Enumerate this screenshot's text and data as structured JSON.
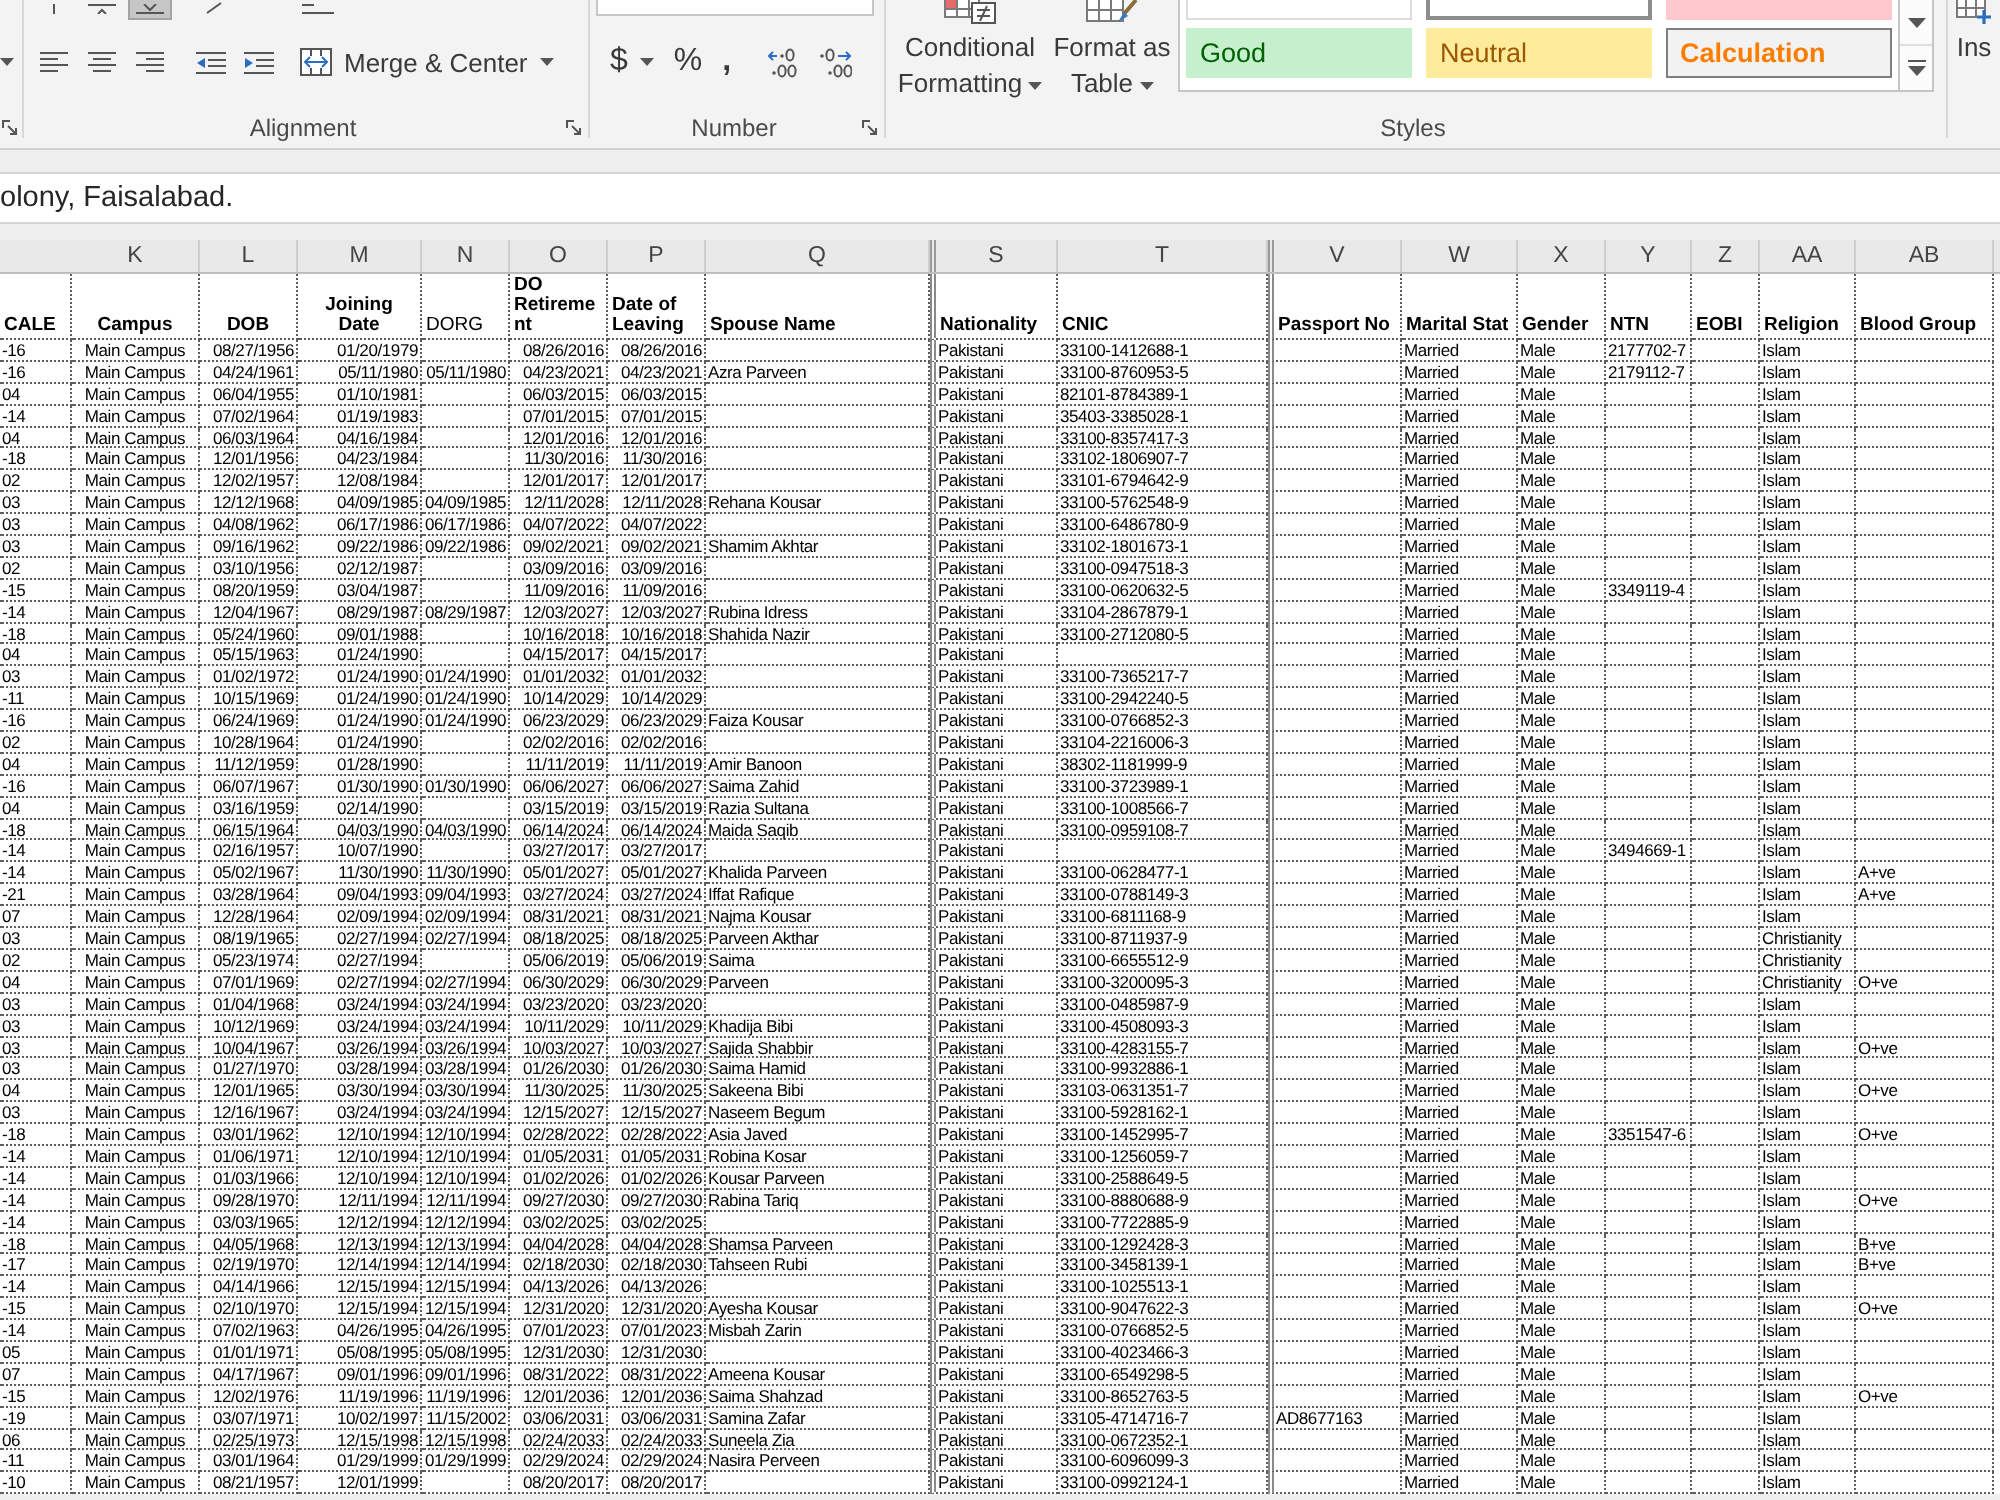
{
  "ribbon": {
    "alignment": {
      "vertical_align": [
        {
          "kind": "top",
          "selected": false
        },
        {
          "kind": "middle",
          "selected": false
        },
        {
          "kind": "bottom",
          "selected": true
        }
      ],
      "horizontal_align": [
        {
          "kind": "left",
          "selected": false
        },
        {
          "kind": "center",
          "selected": false
        },
        {
          "kind": "right",
          "selected": false
        }
      ],
      "merge": "Merge & Center",
      "label": "Alignment"
    },
    "number": {
      "currency": "$",
      "percent": "%",
      "comma": ",",
      "label": "Number"
    },
    "styles": {
      "conditional_formatting": "Conditional Formatting",
      "format_as_table": "Format as Table",
      "gallery": [
        {
          "kind": "normal",
          "selected": false
        },
        {
          "kind": "normal",
          "selected": true
        },
        {
          "kind": "bad",
          "selected": false
        },
        {
          "label": "Good",
          "kind": "good",
          "selected": false
        },
        {
          "label": "Neutral",
          "kind": "neutral",
          "selected": false
        },
        {
          "label": "Calculation",
          "kind": "calculation",
          "selected": false
        }
      ],
      "label": "Styles"
    },
    "cells": {
      "insert": "Ins"
    }
  },
  "formula_bar": {
    "value": "olony, Faisalabad."
  },
  "sheet": {
    "columns": [
      {
        "header": "CALE",
        "kind": "text",
        "header_centered": false,
        "header_bold": true,
        "after_hidden": false
      },
      {
        "letter": "K",
        "header": "Campus",
        "kind": "center",
        "header_centered": true,
        "header_bold": true,
        "after_hidden": false
      },
      {
        "letter": "L",
        "header": "DOB",
        "kind": "date",
        "header_centered": true,
        "header_bold": true,
        "after_hidden": false
      },
      {
        "letter": "M",
        "header": "Joining Date",
        "kind": "date",
        "header_centered": true,
        "header_bold": true,
        "after_hidden": false
      },
      {
        "letter": "N",
        "header": "DORG",
        "kind": "date",
        "header_centered": false,
        "header_bold": false,
        "after_hidden": false
      },
      {
        "letter": "O",
        "header": "DO Retirement",
        "kind": "date",
        "header_centered": false,
        "header_bold": true,
        "after_hidden": false
      },
      {
        "letter": "P",
        "header": "Date of Leaving",
        "kind": "date",
        "header_centered": false,
        "header_bold": true,
        "after_hidden": false
      },
      {
        "letter": "Q",
        "header": "Spouse Name",
        "kind": "text",
        "header_centered": false,
        "header_bold": true,
        "after_hidden": false
      },
      {
        "letter": "S",
        "header": "Nationality",
        "kind": "text",
        "header_centered": false,
        "header_bold": true,
        "after_hidden": true
      },
      {
        "letter": "T",
        "header": "CNIC",
        "kind": "text",
        "header_centered": false,
        "header_bold": true,
        "after_hidden": false
      },
      {
        "letter": "V",
        "header": "Passport No",
        "kind": "text",
        "header_centered": false,
        "header_bold": true,
        "after_hidden": true
      },
      {
        "letter": "W",
        "header": "Marital Stat",
        "kind": "text",
        "header_centered": false,
        "header_bold": true,
        "after_hidden": false
      },
      {
        "letter": "X",
        "header": "Gender",
        "kind": "text",
        "header_centered": false,
        "header_bold": true,
        "after_hidden": false
      },
      {
        "letter": "Y",
        "header": "NTN",
        "kind": "text",
        "header_centered": false,
        "header_bold": true,
        "after_hidden": false
      },
      {
        "letter": "Z",
        "header": "EOBI",
        "kind": "text",
        "header_centered": false,
        "header_bold": true,
        "after_hidden": false
      },
      {
        "letter": "AA",
        "header": "Religion",
        "kind": "text",
        "header_centered": false,
        "header_bold": true,
        "after_hidden": false
      },
      {
        "letter": "AB",
        "header": "Blood Group",
        "kind": "text",
        "header_centered": false,
        "header_bold": true,
        "after_hidden": false
      }
    ],
    "rows": [
      [
        "-16",
        "Main Campus",
        "08/27/1956",
        "01/20/1979",
        null,
        "08/26/2016",
        "08/26/2016",
        null,
        "Pakistani",
        "33100-1412688-1",
        null,
        "Married",
        "Male",
        "2177702-7",
        null,
        "Islam",
        null
      ],
      [
        "-16",
        "Main Campus",
        "04/24/1961",
        "05/11/1980",
        "05/11/1980",
        "04/23/2021",
        "04/23/2021",
        "Azra Parveen",
        "Pakistani",
        "33100-8760953-5",
        null,
        "Married",
        "Male",
        "2179112-7",
        null,
        "Islam",
        null
      ],
      [
        "04",
        "Main Campus",
        "06/04/1955",
        "01/10/1981",
        null,
        "06/03/2015",
        "06/03/2015",
        null,
        "Pakistani",
        "82101-8784389-1",
        null,
        "Married",
        "Male",
        null,
        null,
        "Islam",
        null
      ],
      [
        "-14",
        "Main Campus",
        "07/02/1964",
        "01/19/1983",
        null,
        "07/01/2015",
        "07/01/2015",
        null,
        "Pakistani",
        "35403-3385028-1",
        null,
        "Married",
        "Male",
        null,
        null,
        "Islam",
        null
      ],
      [
        "04",
        "Main Campus",
        "06/03/1964",
        "04/16/1984",
        null,
        "12/01/2016",
        "12/01/2016",
        null,
        "Pakistani",
        "33100-8357417-3",
        null,
        "Married",
        "Male",
        null,
        null,
        "Islam",
        null
      ],
      [
        "-18",
        "Main Campus",
        "12/01/1956",
        "04/23/1984",
        null,
        "11/30/2016",
        "11/30/2016",
        null,
        "Pakistani",
        "33102-1806907-7",
        null,
        "Married",
        "Male",
        null,
        null,
        "Islam",
        null
      ],
      [
        "02",
        "Main Campus",
        "12/02/1957",
        "12/08/1984",
        null,
        "12/01/2017",
        "12/01/2017",
        null,
        "Pakistani",
        "33101-6794642-9",
        null,
        "Married",
        "Male",
        null,
        null,
        "Islam",
        null
      ],
      [
        "03",
        "Main Campus",
        "12/12/1968",
        "04/09/1985",
        "04/09/1985",
        "12/11/2028",
        "12/11/2028",
        "Rehana Kousar",
        "Pakistani",
        "33100-5762548-9",
        null,
        "Married",
        "Male",
        null,
        null,
        "Islam",
        null
      ],
      [
        "03",
        "Main Campus",
        "04/08/1962",
        "06/17/1986",
        "06/17/1986",
        "04/07/2022",
        "04/07/2022",
        null,
        "Pakistani",
        "33100-6486780-9",
        null,
        "Married",
        "Male",
        null,
        null,
        "Islam",
        null
      ],
      [
        "03",
        "Main Campus",
        "09/16/1962",
        "09/22/1986",
        "09/22/1986",
        "09/02/2021",
        "09/02/2021",
        "Shamim Akhtar",
        "Pakistani",
        "33102-1801673-1",
        null,
        "Married",
        "Male",
        null,
        null,
        "Islam",
        null
      ],
      [
        "02",
        "Main Campus",
        "03/10/1956",
        "02/12/1987",
        null,
        "03/09/2016",
        "03/09/2016",
        null,
        "Pakistani",
        "33100-0947518-3",
        null,
        "Married",
        "Male",
        null,
        null,
        "Islam",
        null
      ],
      [
        "-15",
        "Main Campus",
        "08/20/1959",
        "03/04/1987",
        null,
        "11/09/2016",
        "11/09/2016",
        null,
        "Pakistani",
        "33100-0620632-5",
        null,
        "Married",
        "Male",
        "3349119-4",
        null,
        "Islam",
        null
      ],
      [
        "-14",
        "Main Campus",
        "12/04/1967",
        "08/29/1987",
        "08/29/1987",
        "12/03/2027",
        "12/03/2027",
        "Rubina Idress",
        "Pakistani",
        "33104-2867879-1",
        null,
        "Married",
        "Male",
        null,
        null,
        "Islam",
        null
      ],
      [
        "-18",
        "Main Campus",
        "05/24/1960",
        "09/01/1988",
        null,
        "10/16/2018",
        "10/16/2018",
        "Shahida Nazir",
        "Pakistani",
        "33100-2712080-5",
        null,
        "Married",
        "Male",
        null,
        null,
        "Islam",
        null
      ],
      [
        "04",
        "Main Campus",
        "05/15/1963",
        "01/24/1990",
        null,
        "04/15/2017",
        "04/15/2017",
        null,
        "Pakistani",
        null,
        null,
        "Married",
        "Male",
        null,
        null,
        "Islam",
        null
      ],
      [
        "03",
        "Main Campus",
        "01/02/1972",
        "01/24/1990",
        "01/24/1990",
        "01/01/2032",
        "01/01/2032",
        null,
        "Pakistani",
        "33100-7365217-7",
        null,
        "Married",
        "Male",
        null,
        null,
        "Islam",
        null
      ],
      [
        "-11",
        "Main Campus",
        "10/15/1969",
        "01/24/1990",
        "01/24/1990",
        "10/14/2029",
        "10/14/2029",
        null,
        "Pakistani",
        "33100-2942240-5",
        null,
        "Married",
        "Male",
        null,
        null,
        "Islam",
        null
      ],
      [
        "-16",
        "Main Campus",
        "06/24/1969",
        "01/24/1990",
        "01/24/1990",
        "06/23/2029",
        "06/23/2029",
        "Faiza Kousar",
        "Pakistani",
        "33100-0766852-3",
        null,
        "Married",
        "Male",
        null,
        null,
        "Islam",
        null
      ],
      [
        "02",
        "Main Campus",
        "10/28/1964",
        "01/24/1990",
        null,
        "02/02/2016",
        "02/02/2016",
        null,
        "Pakistani",
        "33104-2216006-3",
        null,
        "Married",
        "Male",
        null,
        null,
        "Islam",
        null
      ],
      [
        "04",
        "Main Campus",
        "11/12/1959",
        "01/28/1990",
        null,
        "11/11/2019",
        "11/11/2019",
        "Amir Banoon",
        "Pakistani",
        "38302-1181999-9",
        null,
        "Married",
        "Male",
        null,
        null,
        "Islam",
        null
      ],
      [
        "-16",
        "Main Campus",
        "06/07/1967",
        "01/30/1990",
        "01/30/1990",
        "06/06/2027",
        "06/06/2027",
        "Saima Zahid",
        "Pakistani",
        "33100-3723989-1",
        null,
        "Married",
        "Male",
        null,
        null,
        "Islam",
        null
      ],
      [
        "04",
        "Main Campus",
        "03/16/1959",
        "02/14/1990",
        null,
        "03/15/2019",
        "03/15/2019",
        "Razia Sultana",
        "Pakistani",
        "33100-1008566-7",
        null,
        "Married",
        "Male",
        null,
        null,
        "Islam",
        null
      ],
      [
        "-18",
        "Main Campus",
        "06/15/1964",
        "04/03/1990",
        "04/03/1990",
        "06/14/2024",
        "06/14/2024",
        "Maida Saqib",
        "Pakistani",
        "33100-0959108-7",
        null,
        "Married",
        "Male",
        null,
        null,
        "Islam",
        null
      ],
      [
        "-14",
        "Main Campus",
        "02/16/1957",
        "10/07/1990",
        null,
        "03/27/2017",
        "03/27/2017",
        null,
        "Pakistani",
        null,
        null,
        "Married",
        "Male",
        "3494669-1",
        null,
        "Islam",
        null
      ],
      [
        "-14",
        "Main Campus",
        "05/02/1967",
        "11/30/1990",
        "11/30/1990",
        "05/01/2027",
        "05/01/2027",
        "Khalida Parveen",
        "Pakistani",
        "33100-0628477-1",
        null,
        "Married",
        "Male",
        null,
        null,
        "Islam",
        "A+ve"
      ],
      [
        "-21",
        "Main Campus",
        "03/28/1964",
        "09/04/1993",
        "09/04/1993",
        "03/27/2024",
        "03/27/2024",
        "Iffat Rafique",
        "Pakistani",
        "33100-0788149-3",
        null,
        "Married",
        "Male",
        null,
        null,
        "Islam",
        "A+ve"
      ],
      [
        "07",
        "Main Campus",
        "12/28/1964",
        "02/09/1994",
        "02/09/1994",
        "08/31/2021",
        "08/31/2021",
        "Najma Kousar",
        "Pakistani",
        "33100-6811168-9",
        null,
        "Married",
        "Male",
        null,
        null,
        "Islam",
        null
      ],
      [
        "03",
        "Main Campus",
        "08/19/1965",
        "02/27/1994",
        "02/27/1994",
        "08/18/2025",
        "08/18/2025",
        "Parveen Akthar",
        "Pakistani",
        "33100-8711937-9",
        null,
        "Married",
        "Male",
        null,
        null,
        "Christianity",
        null
      ],
      [
        "02",
        "Main Campus",
        "05/23/1974",
        "02/27/1994",
        null,
        "05/06/2019",
        "05/06/2019",
        "Saima",
        "Pakistani",
        "33100-6655512-9",
        null,
        "Married",
        "Male",
        null,
        null,
        "Christianity",
        null
      ],
      [
        "04",
        "Main Campus",
        "07/01/1969",
        "02/27/1994",
        "02/27/1994",
        "06/30/2029",
        "06/30/2029",
        "Parveen",
        "Pakistani",
        "33100-3200095-3",
        null,
        "Married",
        "Male",
        null,
        null,
        "Christianity",
        "O+ve"
      ],
      [
        "03",
        "Main Campus",
        "01/04/1968",
        "03/24/1994",
        "03/24/1994",
        "03/23/2020",
        "03/23/2020",
        null,
        "Pakistani",
        "33100-0485987-9",
        null,
        "Married",
        "Male",
        null,
        null,
        "Islam",
        null
      ],
      [
        "03",
        "Main Campus",
        "10/12/1969",
        "03/24/1994",
        "03/24/1994",
        "10/11/2029",
        "10/11/2029",
        "Khadija Bibi",
        "Pakistani",
        "33100-4508093-3",
        null,
        "Married",
        "Male",
        null,
        null,
        "Islam",
        null
      ],
      [
        "03",
        "Main Campus",
        "10/04/1967",
        "03/26/1994",
        "03/26/1994",
        "10/03/2027",
        "10/03/2027",
        "Sajida Shabbir",
        "Pakistani",
        "33100-4283155-7",
        null,
        "Married",
        "Male",
        null,
        null,
        "Islam",
        "O+ve"
      ],
      [
        "03",
        "Main Campus",
        "01/27/1970",
        "03/28/1994",
        "03/28/1994",
        "01/26/2030",
        "01/26/2030",
        "Saima Hamid",
        "Pakistani",
        "33100-9932886-1",
        null,
        "Married",
        "Male",
        null,
        null,
        "Islam",
        null
      ],
      [
        "04",
        "Main Campus",
        "12/01/1965",
        "03/30/1994",
        "03/30/1994",
        "11/30/2025",
        "11/30/2025",
        "Sakeena Bibi",
        "Pakistani",
        "33103-0631351-7",
        null,
        "Married",
        "Male",
        null,
        null,
        "Islam",
        "O+ve"
      ],
      [
        "03",
        "Main Campus",
        "12/16/1967",
        "03/24/1994",
        "03/24/1994",
        "12/15/2027",
        "12/15/2027",
        "Naseem Begum",
        "Pakistani",
        "33100-5928162-1",
        null,
        "Married",
        "Male",
        null,
        null,
        "Islam",
        null
      ],
      [
        "-18",
        "Main Campus",
        "03/01/1962",
        "12/10/1994",
        "12/10/1994",
        "02/28/2022",
        "02/28/2022",
        "Asia Javed",
        "Pakistani",
        "33100-1452995-7",
        null,
        "Married",
        "Male",
        "3351547-6",
        null,
        "Islam",
        "O+ve"
      ],
      [
        "-14",
        "Main Campus",
        "01/06/1971",
        "12/10/1994",
        "12/10/1994",
        "01/05/2031",
        "01/05/2031",
        "Robina Kosar",
        "Pakistani",
        "33100-1256059-7",
        null,
        "Married",
        "Male",
        null,
        null,
        "Islam",
        null
      ],
      [
        "-14",
        "Main Campus",
        "01/03/1966",
        "12/10/1994",
        "12/10/1994",
        "01/02/2026",
        "01/02/2026",
        "Kousar Parveen",
        "Pakistani",
        "33100-2588649-5",
        null,
        "Married",
        "Male",
        null,
        null,
        "Islam",
        null
      ],
      [
        "-14",
        "Main Campus",
        "09/28/1970",
        "12/11/1994",
        "12/11/1994",
        "09/27/2030",
        "09/27/2030",
        "Rabina Tariq",
        "Pakistani",
        "33100-8880688-9",
        null,
        "Married",
        "Male",
        null,
        null,
        "Islam",
        "O+ve"
      ],
      [
        "-14",
        "Main Campus",
        "03/03/1965",
        "12/12/1994",
        "12/12/1994",
        "03/02/2025",
        "03/02/2025",
        null,
        "Pakistani",
        "33100-7722885-9",
        null,
        "Married",
        "Male",
        null,
        null,
        "Islam",
        null
      ],
      [
        "-18",
        "Main Campus",
        "04/05/1968",
        "12/13/1994",
        "12/13/1994",
        "04/04/2028",
        "04/04/2028",
        "Shamsa Parveen",
        "Pakistani",
        "33100-1292428-3",
        null,
        "Married",
        "Male",
        null,
        null,
        "Islam",
        "B+ve"
      ],
      [
        "-17",
        "Main Campus",
        "02/19/1970",
        "12/14/1994",
        "12/14/1994",
        "02/18/2030",
        "02/18/2030",
        "Tahseen Rubi",
        "Pakistani",
        "33100-3458139-1",
        null,
        "Married",
        "Male",
        null,
        null,
        "Islam",
        "B+ve"
      ],
      [
        "-14",
        "Main Campus",
        "04/14/1966",
        "12/15/1994",
        "12/15/1994",
        "04/13/2026",
        "04/13/2026",
        null,
        "Pakistani",
        "33100-1025513-1",
        null,
        "Married",
        "Male",
        null,
        null,
        "Islam",
        null
      ],
      [
        "-15",
        "Main Campus",
        "02/10/1970",
        "12/15/1994",
        "12/15/1994",
        "12/31/2020",
        "12/31/2020",
        "Ayesha Kousar",
        "Pakistani",
        "33100-9047622-3",
        null,
        "Married",
        "Male",
        null,
        null,
        "Islam",
        "O+ve"
      ],
      [
        "-14",
        "Main Campus",
        "07/02/1963",
        "04/26/1995",
        "04/26/1995",
        "07/01/2023",
        "07/01/2023",
        "Misbah Zarin",
        "Pakistani",
        "33100-0766852-5",
        null,
        "Married",
        "Male",
        null,
        null,
        "Islam",
        null
      ],
      [
        "05",
        "Main Campus",
        "01/01/1971",
        "05/08/1995",
        "05/08/1995",
        "12/31/2030",
        "12/31/2030",
        null,
        "Pakistani",
        "33100-4023466-3",
        null,
        "Married",
        "Male",
        null,
        null,
        "Islam",
        null
      ],
      [
        "07",
        "Main Campus",
        "04/17/1967",
        "09/01/1996",
        "09/01/1996",
        "08/31/2022",
        "08/31/2022",
        "Ameena Kousar",
        "Pakistani",
        "33100-6549298-5",
        null,
        "Married",
        "Male",
        null,
        null,
        "Islam",
        null
      ],
      [
        "-15",
        "Main Campus",
        "12/02/1976",
        "11/19/1996",
        "11/19/1996",
        "12/01/2036",
        "12/01/2036",
        "Saima Shahzad",
        "Pakistani",
        "33100-8652763-5",
        null,
        "Married",
        "Male",
        null,
        null,
        "Islam",
        "O+ve"
      ],
      [
        "-19",
        "Main Campus",
        "03/07/1971",
        "10/02/1997",
        "11/15/2002",
        "03/06/2031",
        "03/06/2031",
        "Samina Zafar",
        "Pakistani",
        "33105-4714716-7",
        "AD8677163",
        "Married",
        "Male",
        null,
        null,
        "Islam",
        null
      ],
      [
        "06",
        "Main Campus",
        "02/25/1973",
        "12/15/1998",
        "12/15/1998",
        "02/24/2033",
        "02/24/2033",
        "Suneela Zia",
        "Pakistani",
        "33100-0672352-1",
        null,
        "Married",
        "Male",
        null,
        null,
        "Islam",
        null
      ],
      [
        "-11",
        "Main Campus",
        "03/01/1964",
        "01/29/1999",
        "01/29/1999",
        "02/29/2024",
        "02/29/2024",
        "Nasira Perveen",
        "Pakistani",
        "33100-6096099-3",
        null,
        "Married",
        "Male",
        null,
        null,
        "Islam",
        null
      ],
      [
        "-10",
        "Main Campus",
        "08/21/1957",
        "12/01/1999",
        null,
        "08/20/2017",
        "08/20/2017",
        null,
        "Pakistani",
        "33100-0992124-1",
        null,
        "Married",
        "Male",
        null,
        null,
        "Islam",
        null
      ]
    ]
  }
}
